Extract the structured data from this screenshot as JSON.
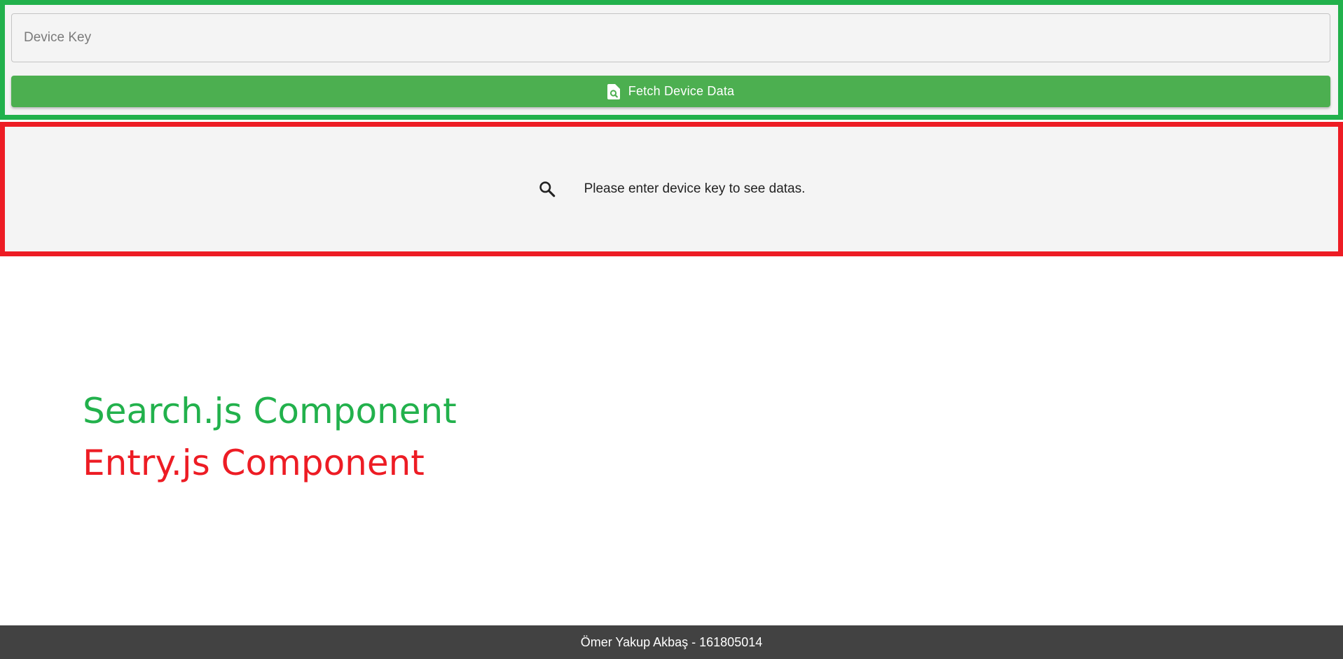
{
  "search": {
    "input_placeholder": "Device Key",
    "input_value": "",
    "button_label": "Fetch Device Data",
    "button_icon": "find-in-page-icon",
    "border_color": "#22b14c",
    "button_color": "#4caf50"
  },
  "entry": {
    "icon": "search-icon",
    "message": "Please enter device key to see datas.",
    "border_color": "#ed1c24"
  },
  "annotations": {
    "search_component": "Search.js Component",
    "entry_component": "Entry.js Component"
  },
  "footer": {
    "text": "Ömer Yakup Akbaş - 161805014"
  }
}
